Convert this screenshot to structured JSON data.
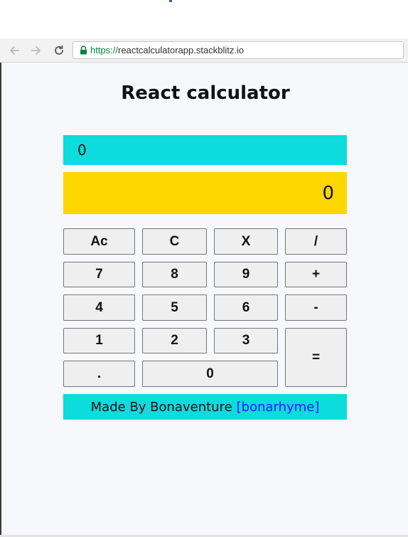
{
  "browser": {
    "url_scheme": "https://",
    "url_host": "reactcalculatorapp.stackblitz.io"
  },
  "app": {
    "title": "React calculator",
    "expression": "0",
    "result": "0",
    "keys": {
      "clear_all": "Ac",
      "clear": "C",
      "multiply": "X",
      "divide": "/",
      "seven": "7",
      "eight": "8",
      "nine": "9",
      "plus": "+",
      "four": "4",
      "five": "5",
      "six": "6",
      "minus": "-",
      "one": "1",
      "two": "2",
      "three": "3",
      "equals": "=",
      "decimal": ".",
      "zero": "0"
    },
    "footer": {
      "made_by": "Made By Bonaventure",
      "handle": "[bonarhyme]"
    }
  },
  "colors": {
    "expression_bg": "#0cdcdc",
    "result_bg": "#ffd700",
    "footer_bg": "#0cdcdc",
    "link": "#1a1aff",
    "url_scheme": "#0b8043"
  },
  "icons": {
    "back": "arrow-left-icon",
    "forward": "arrow-right-icon",
    "reload": "reload-icon",
    "secure": "lock-icon"
  }
}
